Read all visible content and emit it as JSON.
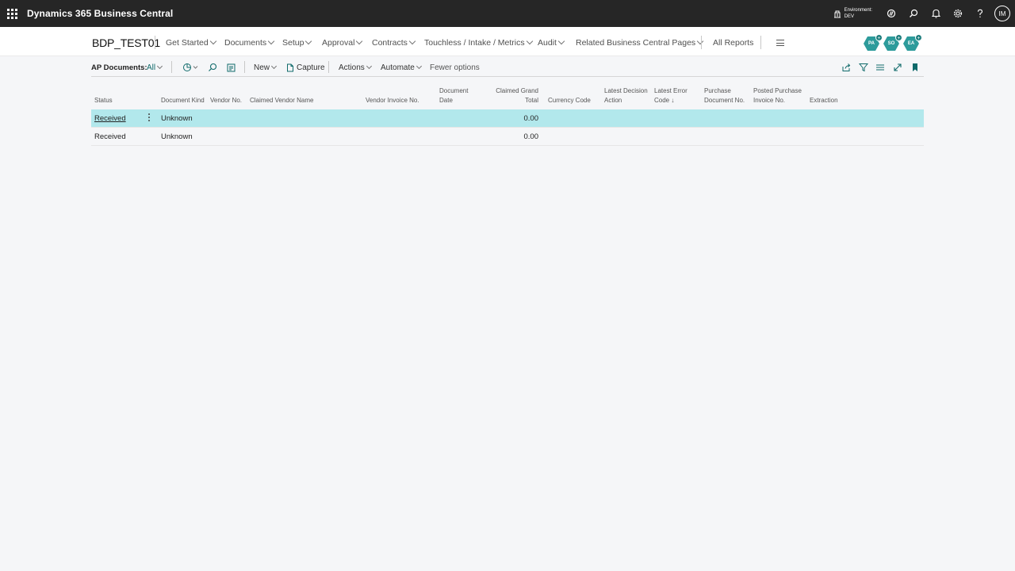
{
  "app": {
    "title": "Dynamics 365 Business Central"
  },
  "top": {
    "env_label": "Environment:",
    "env_value": "DEV",
    "user_initials": "IM"
  },
  "nav": {
    "company": "BDP_TEST01",
    "items": [
      "Get Started",
      "Documents",
      "Setup",
      "Approval",
      "Contracts",
      "Touchless / Intake / Metrics",
      "Audit",
      "Related Business Central Pages"
    ],
    "all_reports": "All Reports",
    "bubbles": [
      "PA",
      "SO",
      "EA"
    ]
  },
  "actions": {
    "page_label": "AP Documents:",
    "view": "All",
    "new": "New",
    "capture": "Capture",
    "actions": "Actions",
    "automate": "Automate",
    "fewer": "Fewer options"
  },
  "table": {
    "headers": {
      "status": "Status",
      "kind": "Document Kind",
      "vendor_no": "Vendor No.",
      "claimed_vendor": "Claimed Vendor Name",
      "vendor_invoice": "Vendor Invoice No.",
      "doc_date_1": "Document",
      "doc_date_2": "Date",
      "grand_total_1": "Claimed Grand",
      "grand_total_2": "Total",
      "currency": "Currency Code",
      "decision_1": "Latest Decision",
      "decision_2": "Action",
      "error_1": "Latest Error",
      "error_2": "Code ↓",
      "purchase_1": "Purchase",
      "purchase_2": "Document No.",
      "posted_1": "Posted Purchase",
      "posted_2": "Invoice No.",
      "extraction": "Extraction"
    },
    "rows": [
      {
        "status": "Received",
        "kind": "Unknown",
        "total": "0.00"
      },
      {
        "status": "Received",
        "kind": "Unknown",
        "total": "0.00"
      }
    ]
  },
  "colors": {
    "accent": "#2d9b9b",
    "topbar": "#262626",
    "selected_row": "#b2e8ec"
  }
}
